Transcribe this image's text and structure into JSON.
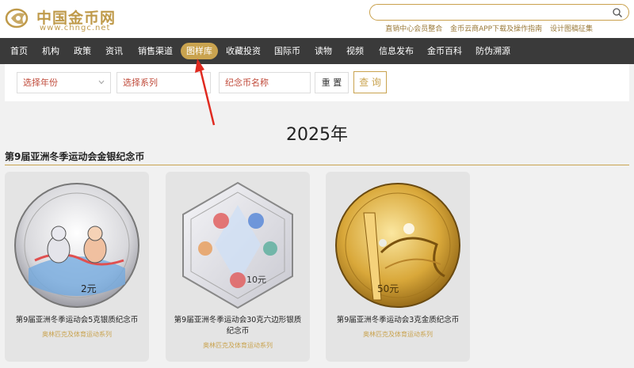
{
  "header": {
    "logo_cn": "中国金币网",
    "logo_en": "www.chngc.net",
    "search_placeholder": "",
    "links": [
      "直销中心会员整合",
      "金币云商APP下载及操作指南",
      "设计图稿征集"
    ]
  },
  "nav": {
    "items": [
      "首页",
      "机构",
      "政策",
      "资讯",
      "销售渠道",
      "图样库",
      "收藏投资",
      "国际币",
      "读物",
      "视频",
      "信息发布",
      "金币百科",
      "防伪溯源"
    ],
    "active": "图样库"
  },
  "filters": {
    "year_placeholder": "选择年份",
    "series_placeholder": "选择系列",
    "name_placeholder": "纪念币名称",
    "reset_label": "重 置",
    "query_label": "查 询"
  },
  "main": {
    "year": "2025年",
    "section_title": "第9届亚洲冬季运动会金银纪念币",
    "cards": [
      {
        "name": "第9届亚洲冬季运动会5克银质纪念币",
        "series": "奥林匹克及体育运动系列",
        "denomination": "2元"
      },
      {
        "name": "第9届亚洲冬季运动会30克六边形银质纪念币",
        "series": "奥林匹克及体育运动系列",
        "denomination": "10元"
      },
      {
        "name": "第9届亚洲冬季运动会3克金质纪念币",
        "series": "奥林匹克及体育运动系列",
        "denomination": "50元"
      }
    ]
  },
  "colors": {
    "gold": "#c9a34f",
    "nav_bg": "#3a3a3a",
    "page_bg": "#f1f1f1",
    "card_bg": "#e4e4e4",
    "placeholder_red": "#c04a3a",
    "annotation_arrow": "#e02a20"
  }
}
